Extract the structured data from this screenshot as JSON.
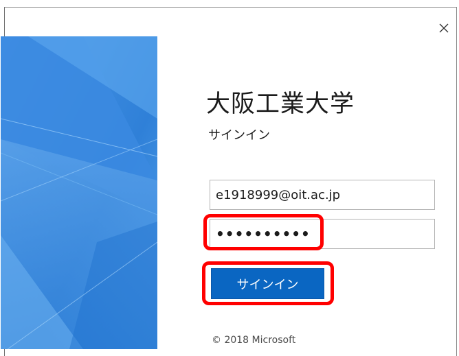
{
  "window": {
    "close_icon": "close-icon"
  },
  "hero": {
    "image": "blue-abstract-background"
  },
  "brand": {
    "title": "大阪工業大学",
    "subtitle": "サインイン"
  },
  "form": {
    "email_value": "e1918999@oit.ac.jp",
    "password_masked": "••••••••••",
    "signin_label": "サインイン"
  },
  "annotations": {
    "highlight_color": "#ff0000"
  },
  "footer": {
    "copyright": "© 2018 Microsoft"
  },
  "colors": {
    "accent": "#0a66c2",
    "hero": "#3d8fe0"
  }
}
